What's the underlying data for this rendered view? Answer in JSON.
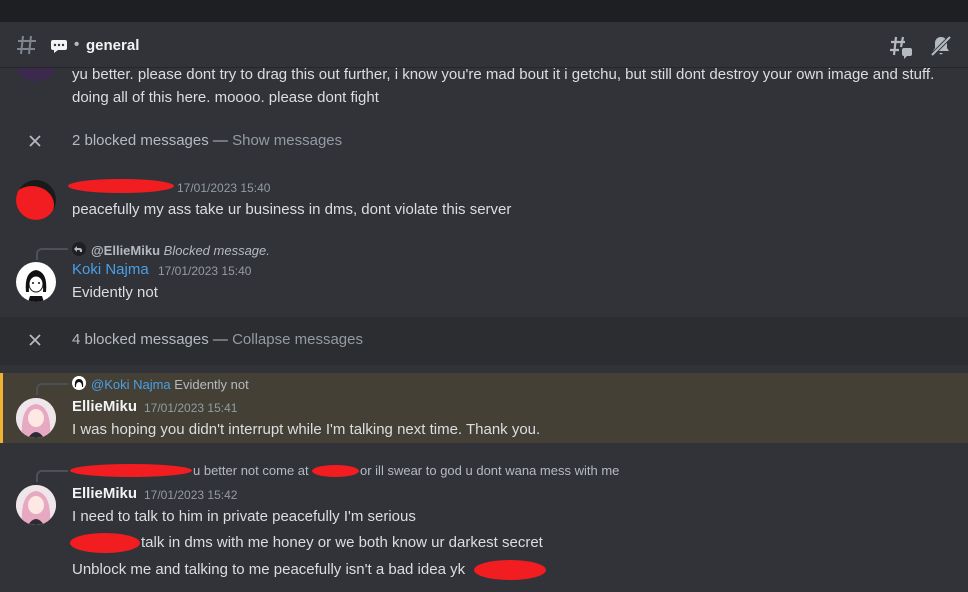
{
  "header": {
    "channel_prefix": "•",
    "channel_name": "general"
  },
  "messages": {
    "top_line1": "yu better. please dont try to drag this out further, i know you're mad bout it i getchu, but still dont destroy your own image and stuff.",
    "top_line2": "doing all of this here. moooo. please dont fight",
    "blocked1_count": "2 blocked messages",
    "blocked1_sep": " — ",
    "blocked1_action": "Show messages",
    "redacted_msg_time": "17/01/2023 15:40",
    "redacted_msg_text": "peacefully my ass take ur business in dms, dont violate this server",
    "koki_reply_user": "@EllieMiku",
    "koki_reply_text": "Blocked message.",
    "koki_name": "Koki Najma",
    "koki_time": "17/01/2023 15:40",
    "koki_text": "Evidently not",
    "blocked2_count": "4 blocked messages",
    "blocked2_sep": " — ",
    "blocked2_action": "Collapse messages",
    "ellie1_reply_user": "@Koki Najma",
    "ellie1_reply_text": "Evidently not",
    "ellie1_name": "EllieMiku",
    "ellie1_time": "17/01/2023 15:41",
    "ellie1_text": "I was hoping you didn't interrupt while I'm talking next time. Thank you.",
    "ellie2_reply_part1": "u better not come at",
    "ellie2_reply_part2": "or ill swear to god u dont wana mess with me",
    "ellie2_name": "EllieMiku",
    "ellie2_time": "17/01/2023 15:42",
    "ellie2_line1": "I need to talk to him in private peacefully I'm serious",
    "ellie2_line2": "talk in dms with me honey or we both know ur darkest secret",
    "ellie2_line3": "Unblock me and talking to me peacefully isn't a bad idea yk"
  },
  "colors": {
    "background": "#313338",
    "koki_name": "#4a9fe8",
    "mention": "#c9cdfb",
    "highlight": "#444035",
    "highlight_border": "#f0b232",
    "redaction": "#f21d21"
  }
}
